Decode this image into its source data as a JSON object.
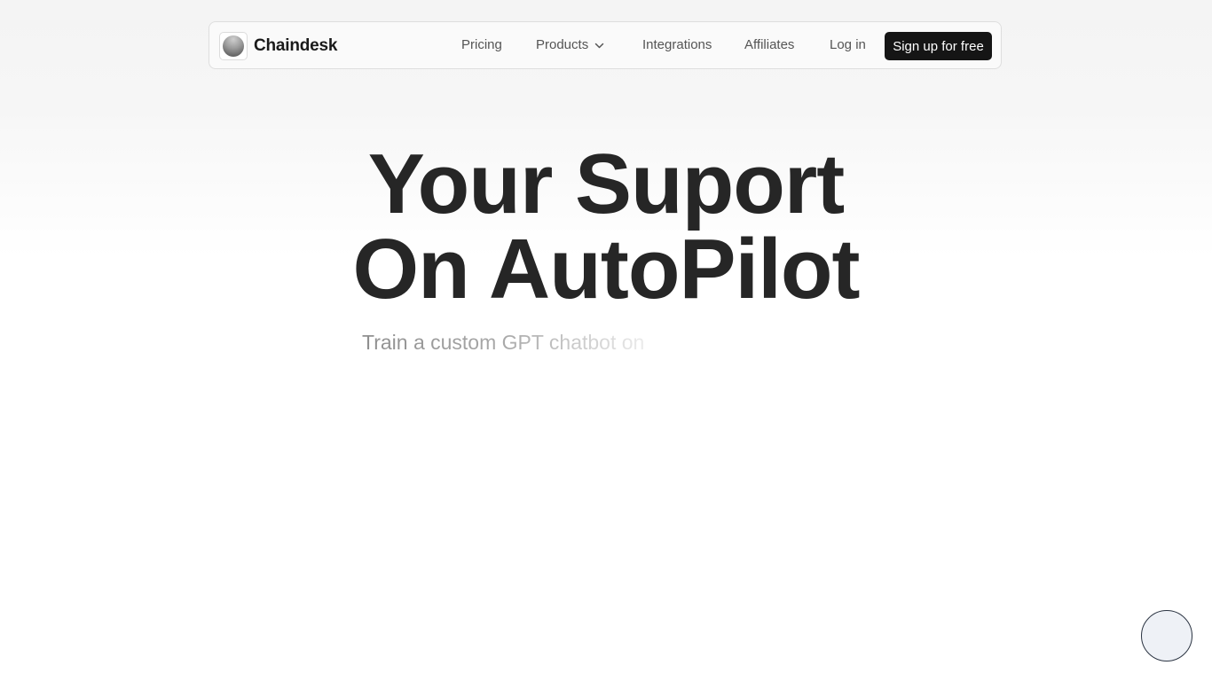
{
  "navbar": {
    "brand_name": "Chaindesk",
    "links": {
      "pricing": "Pricing",
      "products": "Products",
      "integrations": "Integrations",
      "affiliates": "Affiliates",
      "login": "Log in"
    },
    "signup_label": "Sign up for free",
    "products_icon": "chevron-down-icon"
  },
  "hero": {
    "title_line1": "Your Suport",
    "title_line2": "On AutoPilot",
    "subtitle": "Train a custom GPT chatbot on"
  },
  "chat_launcher": {
    "icon": "chat-bubble-icon"
  },
  "colors": {
    "primary_button": "#151515",
    "title_text": "#262626",
    "nav_text": "#555555"
  }
}
